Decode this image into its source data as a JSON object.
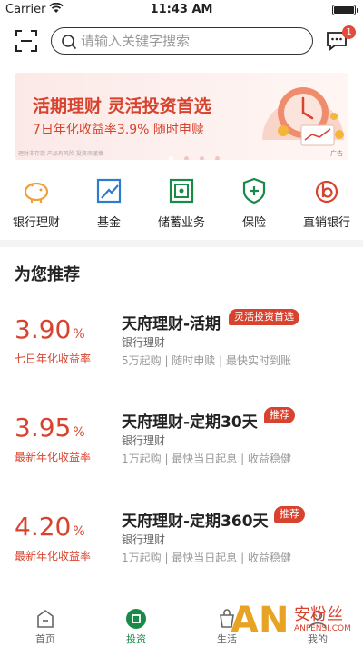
{
  "status_bar": {
    "carrier": "Carrier",
    "time": "11:43 AM"
  },
  "search": {
    "placeholder": "请输入关键字搜索"
  },
  "messages": {
    "badge_count": "1"
  },
  "banner": {
    "title": "活期理财 灵活投资首选",
    "subtitle": "7日年化收益率3.9%  随时申赎",
    "note": "理财非存款 产品有风险 投资须谨慎",
    "ad_label": "广告",
    "dot_count": 4,
    "active_dot": 0
  },
  "categories": [
    {
      "label": "银行理财",
      "icon": "piggy-bank-icon"
    },
    {
      "label": "基金",
      "icon": "chart-trend-icon"
    },
    {
      "label": "储蓄业务",
      "icon": "safe-icon"
    },
    {
      "label": "保险",
      "icon": "shield-plus-icon"
    },
    {
      "label": "直销银行",
      "icon": "direct-bank-icon"
    }
  ],
  "section": {
    "title": "为您推荐"
  },
  "products": [
    {
      "rate": "3.90",
      "unit": "%",
      "rate_label": "七日年化收益率",
      "name": "天府理财-活期",
      "tag": "灵活投资首选",
      "type": "银行理财",
      "desc": "5万起购 | 随时申赎 | 最快实时到账"
    },
    {
      "rate": "3.95",
      "unit": "%",
      "rate_label": "最新年化收益率",
      "name": "天府理财-定期30天",
      "tag": "推荐",
      "type": "银行理财",
      "desc": "1万起购 | 最快当日起息 | 收益稳健"
    },
    {
      "rate": "4.20",
      "unit": "%",
      "rate_label": "最新年化收益率",
      "name": "天府理财-定期360天",
      "tag": "推荐",
      "type": "银行理财",
      "desc": "1万起购 | 最快当日起息 | 收益稳健"
    }
  ],
  "tabs": [
    {
      "label": "首页",
      "icon": "home-icon"
    },
    {
      "label": "投资",
      "icon": "invest-icon",
      "active": true
    },
    {
      "label": "生活",
      "icon": "life-icon"
    },
    {
      "label": "我的",
      "icon": "profile-icon"
    }
  ],
  "watermark": {
    "logo": "AN",
    "text": "安粉丝",
    "url": "ANFENSI.COM"
  },
  "colors": {
    "accent_red": "#d8432f",
    "brand_green": "#1a8a48",
    "icon_orange": "#f0a03a",
    "icon_blue": "#2f7bd0"
  }
}
